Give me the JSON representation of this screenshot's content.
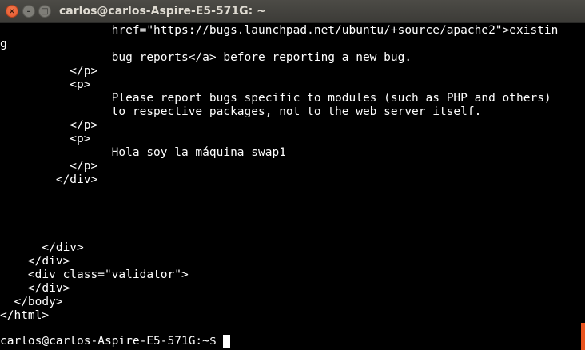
{
  "window": {
    "title": "carlos@carlos-Aspire-E5-571G: ~",
    "close_glyph": "×",
    "minimize_glyph": "–",
    "maximize_glyph": "□"
  },
  "terminal": {
    "lines": [
      "                href=\"https://bugs.launchpad.net/ubuntu/+source/apache2\">existin",
      "g",
      "",
      "                bug reports</a> before reporting a new bug.",
      "          </p>",
      "          <p>",
      "",
      "                Please report bugs specific to modules (such as PHP and others)",
      "                to respective packages, not to the web server itself.",
      "          </p>",
      "          <p>",
      "",
      "                Hola soy la máquina swap1",
      "          </p>",
      "        </div>",
      "",
      "",
      "",
      "",
      "",
      "",
      "      </div>",
      "    </div>",
      "    <div class=\"validator\">",
      "    </div>",
      "  </body>",
      "</html>"
    ],
    "prompt": "carlos@carlos-Aspire-E5-571G:~$ "
  },
  "colors": {
    "background": "#000000",
    "foreground": "#ffffff",
    "titlebar": "#3c3b37",
    "title_text": "#dfdbd2",
    "close_button": "#e2542a",
    "scrollbar_thumb": "#e9541e"
  }
}
